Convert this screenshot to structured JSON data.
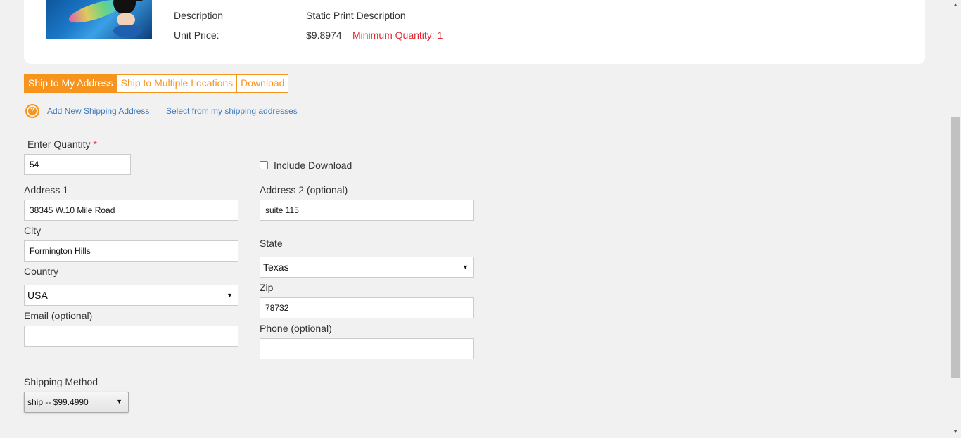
{
  "product": {
    "description_label": "Description",
    "description_value": "Static Print Description",
    "unit_price_label": "Unit Price:",
    "unit_price_value": "$9.8974",
    "min_quantity": "Minimum Quantity: 1"
  },
  "tabs": [
    {
      "label": "Ship to My Address",
      "active": true
    },
    {
      "label": "Ship to Multiple Locations",
      "active": false
    },
    {
      "label": "Download",
      "active": false
    }
  ],
  "links": {
    "add_new": "Add New Shipping Address",
    "select_existing": "Select from my shipping addresses"
  },
  "form": {
    "quantity_label": "Enter Quantity",
    "required_mark": "*",
    "quantity_value": "54",
    "include_download_label": "Include Download",
    "include_download_checked": false,
    "address1_label": "Address 1",
    "address1_value": "38345 W.10 Mile Road",
    "address2_label": "Address 2 (optional)",
    "address2_value": "suite 115",
    "city_label": "City",
    "city_value": "Formington Hills",
    "state_label": "State",
    "state_value": "Texas",
    "country_label": "Country",
    "country_value": "USA",
    "zip_label": "Zip",
    "zip_value": "78732",
    "email_label": "Email (optional)",
    "email_value": "",
    "phone_label": "Phone (optional)",
    "phone_value": "",
    "shipping_method_label": "Shipping Method",
    "shipping_method_value": "ship -- $99.4990"
  },
  "colors": {
    "accent": "#f7941d",
    "link": "#3b7bbf",
    "error": "#e0262f"
  }
}
